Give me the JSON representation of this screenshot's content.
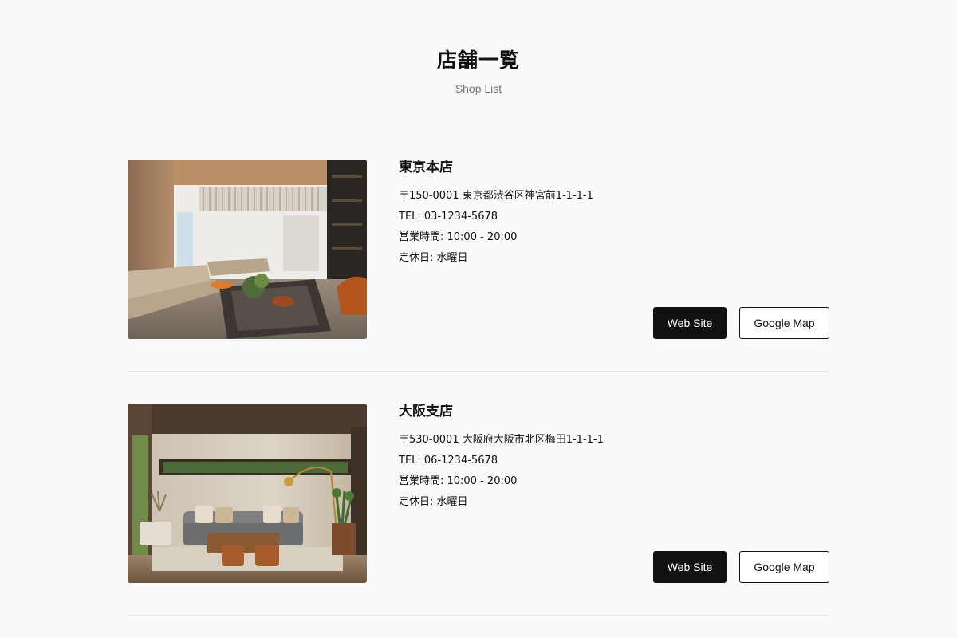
{
  "header": {
    "title": "店舗一覧",
    "subtitle": "Shop List"
  },
  "shops": [
    {
      "name": "東京本店",
      "address": "〒150-0001 東京都渋谷区神宮前1-1-1-1",
      "tel": "TEL: 03-1234-5678",
      "hours": "営業時間: 10:00 - 20:00",
      "closed": "定休日: 水曜日",
      "website_label": "Web Site",
      "map_label": "Google Map",
      "photo": "modern-living-room-photo"
    },
    {
      "name": "大阪支店",
      "address": "〒530-0001 大阪府大阪市北区梅田1-1-1-1",
      "tel": "TEL: 06-1234-5678",
      "hours": "営業時間: 10:00 - 20:00",
      "closed": "定休日: 水曜日",
      "website_label": "Web Site",
      "map_label": "Google Map",
      "photo": "sunlit-living-room-photo"
    }
  ]
}
